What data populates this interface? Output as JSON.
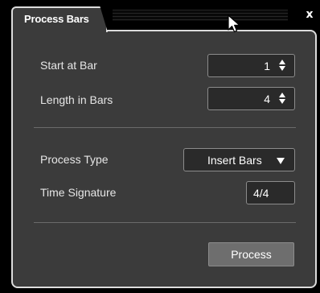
{
  "window": {
    "tab_title": "Process Bars",
    "close_glyph": "x"
  },
  "fields": {
    "start_at_bar": {
      "label": "Start at Bar",
      "value": "1"
    },
    "length_in_bars": {
      "label": "Length in Bars",
      "value": "4"
    },
    "process_type": {
      "label": "Process Type",
      "value": "Insert Bars"
    },
    "time_signature": {
      "label": "Time Signature",
      "value": "4/4"
    }
  },
  "actions": {
    "process_label": "Process"
  },
  "icons": {
    "close": "close-icon",
    "spinner": "spinner-icon",
    "dropdown": "chevron-down-icon",
    "cursor": "mouse-cursor-icon"
  }
}
